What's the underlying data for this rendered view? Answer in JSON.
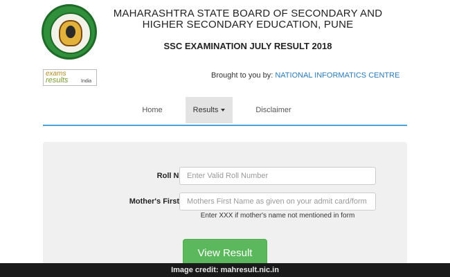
{
  "header": {
    "board_title": "MAHARASHTRA STATE BOARD OF SECONDARY AND HIGHER SECONDARY EDUCATION, PUNE",
    "exam_title": "SSC EXAMINATION JULY RESULT 2018"
  },
  "brand": {
    "exams": "exams",
    "results": "results",
    "india": "India"
  },
  "provider": {
    "prefix": "Brought to you by: ",
    "org": "NATIONAL INFORMATICS CENTRE"
  },
  "nav": {
    "home": "Home",
    "results": "Results",
    "disclaimer": "Disclaimer"
  },
  "form": {
    "roll_label": "Roll Number:*",
    "roll_placeholder": "Enter Valid Roll Number",
    "mother_label": "Mother's First Name:*",
    "mother_placeholder": "Mothers First Name as given on your admit card/form",
    "hint": "Enter XXX if mother's name not mentioned in form",
    "submit": "View Result"
  },
  "credit": "Image credit: mahresult.nic.in",
  "colors": {
    "accent_line": "#4aa3d8",
    "link": "#2a7ab8",
    "button": "#5cb85c",
    "logo_green": "#2f8f3a"
  },
  "icons": {
    "logo": "board-seal-icon",
    "caret": "caret-down-icon"
  }
}
